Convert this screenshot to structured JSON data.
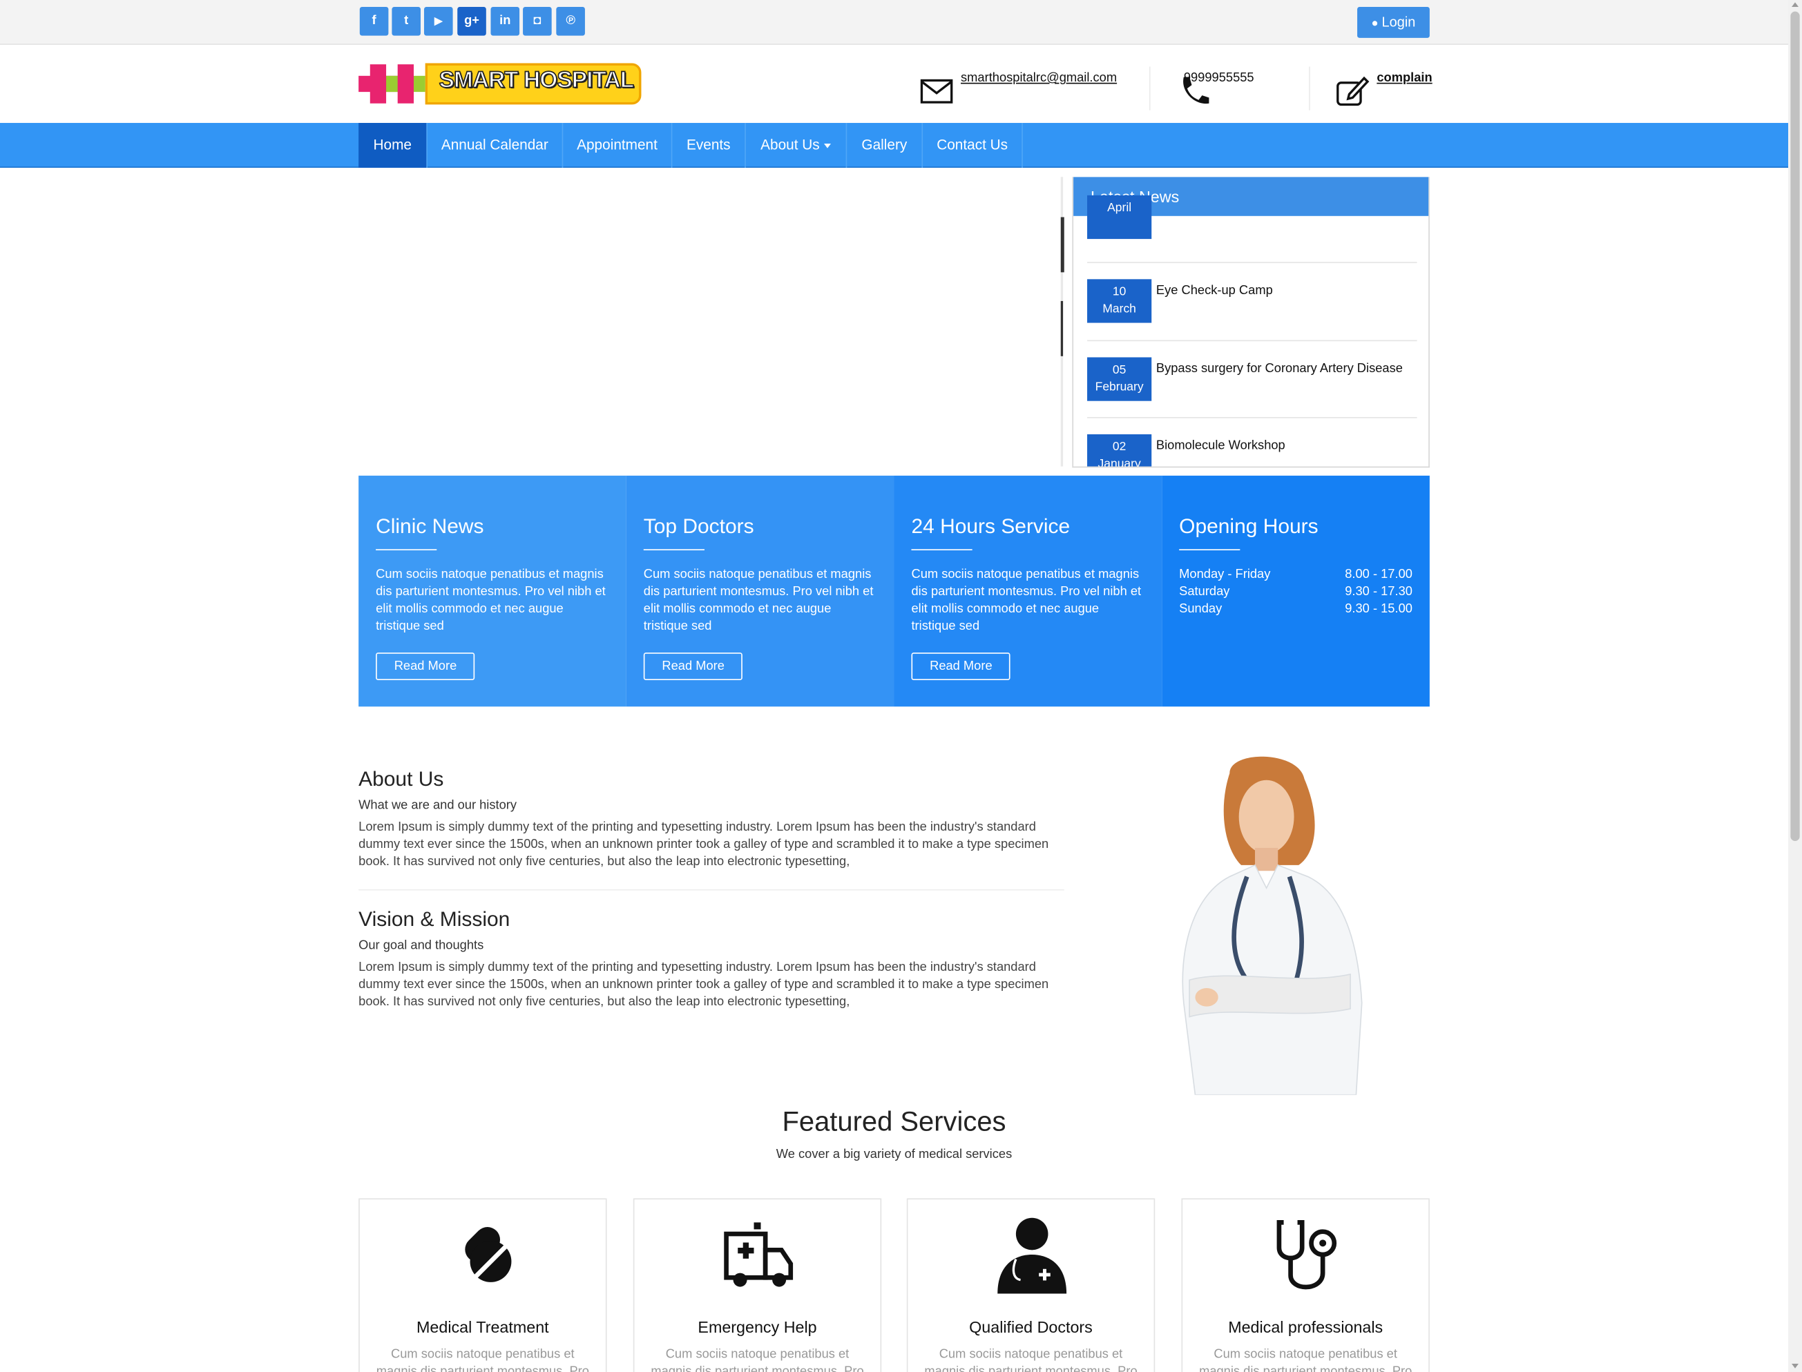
{
  "topbar": {
    "social": [
      {
        "icon": "facebook-icon",
        "glyph": "f"
      },
      {
        "icon": "twitter-icon",
        "glyph": "t"
      },
      {
        "icon": "youtube-icon",
        "glyph": "▶"
      },
      {
        "icon": "google-plus-icon",
        "glyph": "g+"
      },
      {
        "icon": "linkedin-icon",
        "glyph": "in"
      },
      {
        "icon": "instagram-icon",
        "glyph": "◘"
      },
      {
        "icon": "pinterest-icon",
        "glyph": "℗"
      }
    ],
    "login_label": "Login"
  },
  "header": {
    "logo_text": "SMART HOSPITAL",
    "email": "smarthospitalrc@gmail.com",
    "phone": "9999955555",
    "complain": "complain"
  },
  "nav": {
    "items": [
      "Home",
      "Annual Calendar",
      "Appointment",
      "Events",
      "About Us",
      "Gallery",
      "Contact Us"
    ]
  },
  "news": {
    "title": "Latest News",
    "items": [
      {
        "day": "",
        "month": "April",
        "title": ""
      },
      {
        "day": "10",
        "month": "March",
        "title": "Eye Check-up Camp"
      },
      {
        "day": "05",
        "month": "February",
        "title": "Bypass surgery for Coronary Artery Disease"
      },
      {
        "day": "02",
        "month": "January",
        "title": "Biomolecule Workshop"
      }
    ]
  },
  "panels": [
    {
      "title": "Clinic News",
      "text": "Cum sociis natoque penatibus et magnis dis parturient montesmus. Pro vel nibh et elit mollis commodo et nec augue tristique sed",
      "button": "Read More",
      "color": "#3d9af5"
    },
    {
      "title": "Top Doctors",
      "text": "Cum sociis natoque penatibus et magnis dis parturient montesmus. Pro vel nibh et elit mollis commodo et nec augue tristique sed",
      "button": "Read More",
      "color": "#3493f5"
    },
    {
      "title": "24 Hours Service",
      "text": "Cum sociis natoque penatibus et magnis dis parturient montesmus. Pro vel nibh et elit mollis commodo et nec augue tristique sed",
      "button": "Read More",
      "color": "#2489f5"
    },
    {
      "title": "Opening Hours",
      "color": "#1580f4",
      "hours": [
        {
          "day": "Monday - Friday",
          "time": "8.00 - 17.00"
        },
        {
          "day": "Saturday",
          "time": "9.30 - 17.30"
        },
        {
          "day": "Sunday",
          "time": "9.30 - 15.00"
        }
      ]
    }
  ],
  "about": {
    "title": "About Us",
    "subtitle": "What we are and our history",
    "body": "Lorem Ipsum is simply dummy text of the printing and typesetting industry. Lorem Ipsum has been the industry's standard dummy text ever since the 1500s, when an unknown printer took a galley of type and scrambled it to make a type specimen book. It has survived not only five centuries, but also the leap into electronic typesetting,"
  },
  "vision": {
    "title": "Vision & Mission",
    "subtitle": "Our goal and thoughts",
    "body": "Lorem Ipsum is simply dummy text of the printing and typesetting industry. Lorem Ipsum has been the industry's standard dummy text ever since the 1500s, when an unknown printer took a galley of type and scrambled it to make a type specimen book. It has survived not only five centuries, but also the leap into electronic typesetting,"
  },
  "featured": {
    "title": "Featured Services",
    "subtitle": "We cover a big variety of medical services",
    "cards": [
      {
        "icon": "pills-icon",
        "title": "Medical Treatment",
        "text": "Cum sociis natoque penatibus et magnis dis parturient montesmus. Pro vel nibh et"
      },
      {
        "icon": "ambulance-icon",
        "title": "Emergency Help",
        "text": "Cum sociis natoque penatibus et magnis dis parturient montesmus. Pro vel nibh et"
      },
      {
        "icon": "doctor-icon",
        "title": "Qualified Doctors",
        "text": "Cum sociis natoque penatibus et magnis dis parturient montesmus. Pro vel nibh et"
      },
      {
        "icon": "stethoscope-icon",
        "title": "Medical professionals",
        "text": "Cum sociis natoque penatibus et magnis dis parturient montesmus. Pro vel nibh et"
      }
    ]
  },
  "colors": {
    "primary": "#3295f5",
    "active": "#0f5cc2",
    "accent_logo": "#ffd11a"
  }
}
